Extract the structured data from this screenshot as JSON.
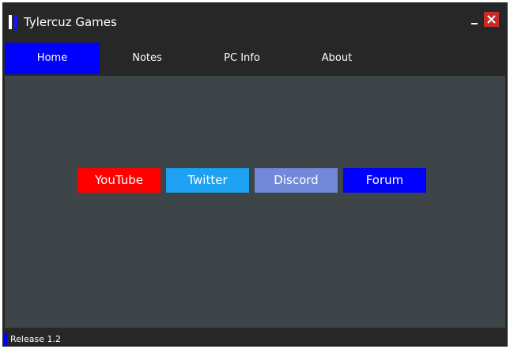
{
  "app": {
    "title": "Tylercuz Games"
  },
  "nav": {
    "tabs": [
      {
        "label": "Home",
        "active": true
      },
      {
        "label": "Notes",
        "active": false
      },
      {
        "label": "PC Info",
        "active": false
      },
      {
        "label": "About",
        "active": false
      }
    ]
  },
  "links": [
    {
      "label": "YouTube",
      "color": "#ff0000"
    },
    {
      "label": "Twitter",
      "color": "#1da1f2"
    },
    {
      "label": "Discord",
      "color": "#7289da"
    },
    {
      "label": "Forum",
      "color": "#0000ff"
    }
  ],
  "status": {
    "release": "Release 1.2"
  },
  "colors": {
    "window_bg": "#272727",
    "content_bg": "#3e4548",
    "accent": "#0000ff",
    "close": "#c42b2b"
  },
  "icons": {
    "logo": "logo-bars-icon",
    "minimize": "minimize-icon",
    "close": "close-icon"
  }
}
